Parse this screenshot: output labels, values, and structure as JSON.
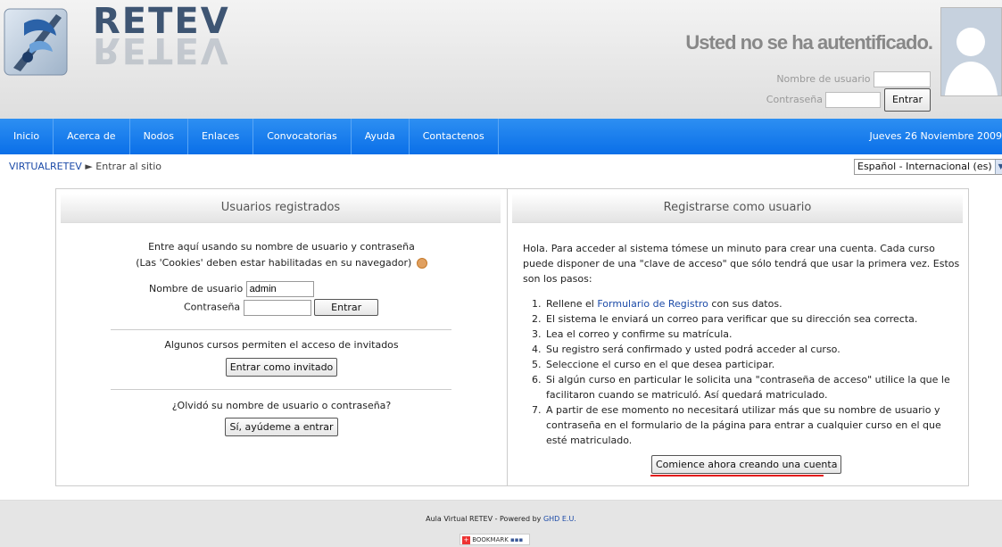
{
  "header": {
    "logo_text": "RETEV",
    "auth_status": "Usted no se ha autentificado.",
    "username_label": "Nombre de usuario",
    "password_label": "Contraseña",
    "login_button": "Entrar"
  },
  "nav": {
    "items": [
      "Inicio",
      "Acerca de",
      "Nodos",
      "Enlaces",
      "Convocatorias",
      "Ayuda",
      "Contactenos"
    ],
    "date": "Jueves 26 Noviembre 2009"
  },
  "breadcrumb": {
    "home": "VIRTUALRETEV",
    "separator": "►",
    "current": "Entrar al sitio"
  },
  "language": {
    "selected": "Español - Internacional (es)"
  },
  "left_panel": {
    "title": "Usuarios registrados",
    "intro_line1": "Entre aquí usando su nombre de usuario y contraseña",
    "intro_line2": "(Las 'Cookies' deben estar habilitadas en su navegador)",
    "username_label": "Nombre de usuario",
    "username_value": "admin",
    "password_label": "Contraseña",
    "login_button": "Entrar",
    "guest_text": "Algunos cursos permiten el acceso de invitados",
    "guest_button": "Entrar como invitado",
    "forgot_text": "¿Olvidó su nombre de usuario o contraseña?",
    "forgot_button": "Sí, ayúdeme a entrar"
  },
  "right_panel": {
    "title": "Registrarse como usuario",
    "intro": "Hola. Para acceder al sistema tómese un minuto para crear una cuenta. Cada curso puede disponer de una \"clave de acceso\" que sólo tendrá que usar la primera vez. Estos son los pasos:",
    "step1_prefix": "Rellene el",
    "step1_link": "Formulario de Registro",
    "step1_suffix": "con sus datos.",
    "steps": [
      "El sistema le enviará un correo para verificar que su dirección sea correcta.",
      "Lea el correo y confirme su matrícula.",
      "Su registro será confirmado y usted podrá acceder al curso.",
      "Seleccione el curso en el que desea participar.",
      "Si algún curso en particular le solicita una \"contraseña de acceso\" utilice la que le facilitaron cuando se matriculó. Así quedará matriculado.",
      "A partir de ese momento no necesitará utilizar más que su nombre de usuario y contraseña en el formulario de la página para entrar a cualquier curso en el que esté matriculado."
    ],
    "create_button": "Comience ahora creando una cuenta"
  },
  "footer": {
    "text": "Aula Virtual RETEV - Powered by",
    "link": "GHD E.U.",
    "bookmark": "BOOKMARK"
  }
}
